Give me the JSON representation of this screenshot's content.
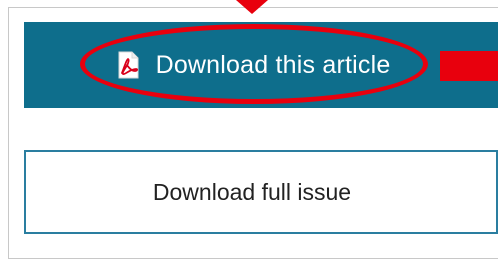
{
  "buttons": {
    "download_article_label": "Download this article",
    "download_issue_label": "Download full issue"
  },
  "icons": {
    "pdf": "pdf-file-icon"
  },
  "colors": {
    "primary_button_bg": "#0e6e8c",
    "secondary_button_border": "#2a7ea0",
    "annotation": "#e8000d"
  }
}
